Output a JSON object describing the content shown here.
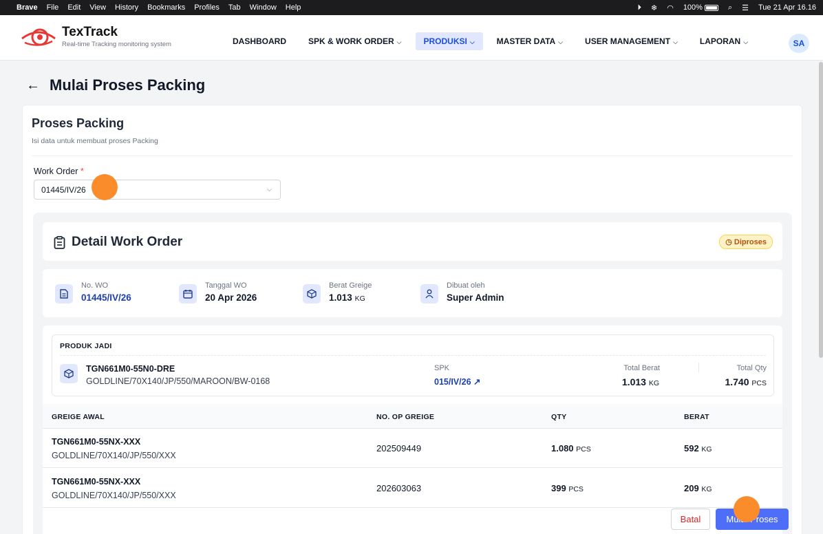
{
  "menubar": {
    "app": "Brave",
    "items": [
      "File",
      "Edit",
      "View",
      "History",
      "Bookmarks",
      "Profiles",
      "Tab",
      "Window",
      "Help"
    ],
    "battery": "100%",
    "datetime": "Tue 21 Apr 16.16"
  },
  "brand": {
    "name": "TexTrack",
    "tagline": "Real-time Tracking monitoring system"
  },
  "nav": {
    "dashboard": "DASHBOARD",
    "spk": "SPK & WORK ORDER",
    "produksi": "PRODUKSI",
    "master": "MASTER DATA",
    "user": "USER MANAGEMENT",
    "laporan": "LAPORAN"
  },
  "user": {
    "initials": "SA"
  },
  "page": {
    "title": "Mulai Proses Packing"
  },
  "form": {
    "title": "Proses Packing",
    "subtitle": "Isi data untuk membuat proses Packing",
    "wo_label": "Work Order",
    "wo_required": "*",
    "wo_value": "01445/IV/26"
  },
  "detail": {
    "title": "Detail Work Order",
    "status": "Diproses",
    "no_wo_label": "No. WO",
    "no_wo": "01445/IV/26",
    "tanggal_label": "Tanggal WO",
    "tanggal": "20 Apr 2026",
    "berat_label": "Berat Greige",
    "berat": "1.013",
    "berat_unit": "KG",
    "dibuat_label": "Dibuat oleh",
    "dibuat": "Super Admin"
  },
  "produk": {
    "header": "PRODUK JADI",
    "code": "TGN661M0-55N0-DRE",
    "desc": "GOLDLINE/70X140/JP/550/MAROON/BW-0168",
    "spk_label": "SPK",
    "spk": "015/IV/26",
    "total_berat_label": "Total Berat",
    "total_berat": "1.013",
    "total_berat_unit": "KG",
    "total_qty_label": "Total Qty",
    "total_qty": "1.740",
    "total_qty_unit": "PCS"
  },
  "table": {
    "headers": [
      "GREIGE AWAL",
      "NO. OP GREIGE",
      "QTY",
      "BERAT"
    ],
    "rows": [
      {
        "code": "TGN661M0-55NX-XXX",
        "desc": "GOLDLINE/70X140/JP/550/XXX",
        "op": "202509449",
        "qty": "1.080",
        "qty_unit": "PCS",
        "berat": "592",
        "berat_unit": "KG"
      },
      {
        "code": "TGN661M0-55NX-XXX",
        "desc": "GOLDLINE/70X140/JP/550/XXX",
        "op": "202603063",
        "qty": "399",
        "qty_unit": "PCS",
        "berat": "209",
        "berat_unit": "KG"
      }
    ]
  },
  "actions": {
    "cancel": "Batal",
    "start": "Mulai Proses"
  },
  "colors": {
    "accent": "#4f6ef7",
    "brand": "#e53935",
    "status": "#b45309",
    "marker": "#fb8c2c"
  }
}
